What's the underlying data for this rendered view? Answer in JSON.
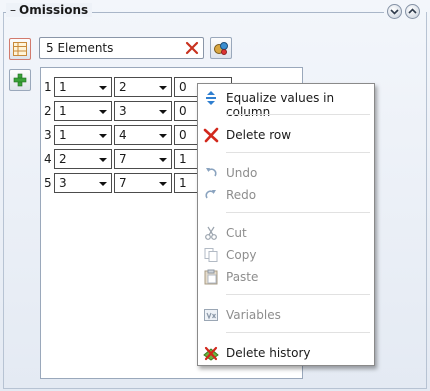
{
  "group": {
    "dash": "–",
    "title": "Omissions"
  },
  "toolbar": {
    "elements_value": "5 Elements"
  },
  "rows": [
    {
      "index": "1",
      "a": "1",
      "b": "2",
      "c": "0"
    },
    {
      "index": "2",
      "a": "1",
      "b": "3",
      "c": "0"
    },
    {
      "index": "3",
      "a": "1",
      "b": "4",
      "c": "0"
    },
    {
      "index": "4",
      "a": "2",
      "b": "7",
      "c": "1"
    },
    {
      "index": "5",
      "a": "3",
      "b": "7",
      "c": "1"
    }
  ],
  "menu": {
    "equalize": "Equalize values in column",
    "delete_row": "Delete row",
    "undo": "Undo",
    "redo": "Redo",
    "cut": "Cut",
    "copy": "Copy",
    "paste": "Paste",
    "variables": "Variables",
    "delete_history": "Delete history"
  }
}
